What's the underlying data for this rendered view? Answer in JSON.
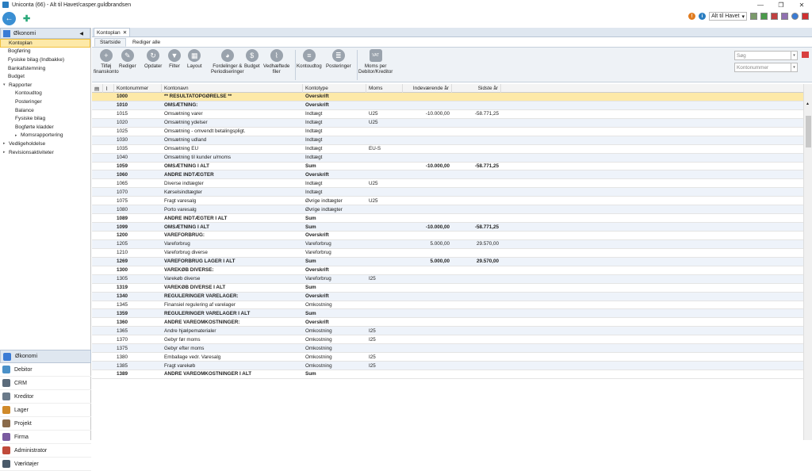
{
  "window": {
    "title": "Uniconta (66) - Alt til Havet/casper.guldbrandsen"
  },
  "topbar": {
    "company": "Alt til Havet"
  },
  "left": {
    "header": "Økonomi",
    "nav": [
      {
        "label": "Kontoplan",
        "level": 0,
        "selected": true
      },
      {
        "label": "Bogføring",
        "level": 0
      },
      {
        "label": "Fysiske bilag (Indbakke)",
        "level": 0
      },
      {
        "label": "Bankafstemning",
        "level": 0
      },
      {
        "label": "Budget",
        "level": 0
      },
      {
        "label": "Rapporter",
        "level": 1,
        "arrow": "▾"
      },
      {
        "label": "Kontoudtog",
        "level": 2
      },
      {
        "label": "Posteringer",
        "level": 2
      },
      {
        "label": "Balance",
        "level": 2
      },
      {
        "label": "Fysiske bilag",
        "level": 2
      },
      {
        "label": "Bogførte kladder",
        "level": 2
      },
      {
        "label": "Momsrapportering",
        "level": 2,
        "arrow": "▸"
      },
      {
        "label": "Vedligeholdelse",
        "level": 1,
        "arrow": "▸"
      },
      {
        "label": "Revisionsaktiviteter",
        "level": 1,
        "arrow": "▸"
      }
    ],
    "modules": [
      {
        "label": "Økonomi",
        "color": "#3a7bd5",
        "selected": true
      },
      {
        "label": "Debitor",
        "color": "#4a90c8"
      },
      {
        "label": "CRM",
        "color": "#5b6b7b"
      },
      {
        "label": "Kreditor",
        "color": "#6a7a8a"
      },
      {
        "label": "Lager",
        "color": "#d08a2a"
      },
      {
        "label": "Projekt",
        "color": "#8a6a4a"
      },
      {
        "label": "Firma",
        "color": "#7a5aa0"
      },
      {
        "label": "Administrator",
        "color": "#c04a3a"
      },
      {
        "label": "Værktøjer",
        "color": "#4a5a6a"
      }
    ]
  },
  "tabs": {
    "doc": "Kontoplan",
    "ribbon": [
      "Startside",
      "Rediger alle"
    ]
  },
  "ribbon": {
    "buttons": [
      {
        "label": "Tilføj\nfinanskonto",
        "glyph": "+"
      },
      {
        "label": "Rediger",
        "glyph": "✎"
      },
      {
        "label": "Opdater",
        "glyph": "↻"
      },
      {
        "label": "Filter",
        "glyph": "▼"
      },
      {
        "label": "Layout",
        "glyph": "▦"
      },
      {
        "label": "Fordelinger &\nPeriodiseringer",
        "glyph": "◕"
      },
      {
        "label": "Budget",
        "glyph": "$"
      },
      {
        "label": "Vedhæftede\nfiler",
        "glyph": "⌇"
      },
      {
        "label": "Kontoudtog",
        "glyph": "≡"
      },
      {
        "label": "Posteringer",
        "glyph": "≣"
      },
      {
        "label": "Moms per\nDebitor/Kreditor",
        "glyph": "VAT"
      }
    ],
    "search_placeholder": "Søg",
    "field_placeholder": "Kontonummer"
  },
  "grid": {
    "headers": [
      "Kontonummer",
      "Kontonavn",
      "Kontotype",
      "Moms",
      "Indeværende år",
      "Sidste år"
    ],
    "rows": [
      [
        "1000",
        "** RESULTATOPGØRELSE **",
        "Overskrift",
        "",
        "",
        "",
        "bold"
      ],
      [
        "1010",
        "OMSÆTNING:",
        "Overskrift",
        "",
        "",
        "",
        "bold"
      ],
      [
        "1015",
        "Omsætning varer",
        "Indtægt",
        "U25",
        "-10.000,00",
        "-58.771,25",
        ""
      ],
      [
        "1020",
        "Omsætning ydelser",
        "Indtægt",
        "U25",
        "",
        "",
        ""
      ],
      [
        "1025",
        "Omsætning -  omvendt betalingspligt.",
        "Indtægt",
        "",
        "",
        "",
        ""
      ],
      [
        "1030",
        "Omsætning udland",
        "Indtægt",
        "",
        "",
        "",
        ""
      ],
      [
        "1035",
        "Omsætning EU",
        "Indtægt",
        "EU-S",
        "",
        "",
        ""
      ],
      [
        "1040",
        "Omsætning til kunder u/moms",
        "Indtægt",
        "",
        "",
        "",
        ""
      ],
      [
        "1059",
        "OMSÆTNING I ALT",
        "Sum",
        "",
        "-10.000,00",
        "-58.771,25",
        "bold"
      ],
      [
        "1060",
        "ANDRE INDTÆGTER",
        "Overskrift",
        "",
        "",
        "",
        "bold"
      ],
      [
        "1065",
        "Diverse indtægter",
        "Indtægt",
        "U25",
        "",
        "",
        ""
      ],
      [
        "1070",
        "Kørselsindtægter",
        "Indtægt",
        "",
        "",
        "",
        ""
      ],
      [
        "1075",
        "Fragt varesalg",
        "Øvrige indtægter",
        "U25",
        "",
        "",
        ""
      ],
      [
        "1080",
        "Porto varesalg",
        "Øvrige indtægter",
        "",
        "",
        "",
        ""
      ],
      [
        "1089",
        "ANDRE INDTÆGTER I ALT",
        "Sum",
        "",
        "",
        "",
        "bold"
      ],
      [
        "1099",
        "OMSÆTNING I ALT",
        "Sum",
        "",
        "-10.000,00",
        "-58.771,25",
        "bold"
      ],
      [
        "1200",
        "VAREFORBRUG:",
        "Overskrift",
        "",
        "",
        "",
        "bold"
      ],
      [
        "1205",
        "Vareforbrug",
        "Vareforbrug",
        "",
        "5.000,00",
        "29.570,00",
        ""
      ],
      [
        "1210",
        "Vareforbrug diverse",
        "Vareforbrug",
        "",
        "",
        "",
        ""
      ],
      [
        "1269",
        "VAREFORBRUG LAGER I ALT",
        "Sum",
        "",
        "5.000,00",
        "29.570,00",
        "bold"
      ],
      [
        "1300",
        "VAREKØB DIVERSE:",
        "Overskrift",
        "",
        "",
        "",
        "bold"
      ],
      [
        "1305",
        "Varekøb  diverse",
        "Vareforbrug",
        "I25",
        "",
        "",
        ""
      ],
      [
        "1319",
        "VAREKØB DIVERSE I ALT",
        "Sum",
        "",
        "",
        "",
        "bold"
      ],
      [
        "1340",
        "REGULERINGER VARELAGER:",
        "Overskrift",
        "",
        "",
        "",
        "bold"
      ],
      [
        "1345",
        "Finansiel regulering af varelager",
        "Omkostning",
        "",
        "",
        "",
        ""
      ],
      [
        "1359",
        "REGULERINGER VARELAGER I ALT",
        "Sum",
        "",
        "",
        "",
        "bold"
      ],
      [
        "1360",
        "ANDRE VAREOMKOSTNINGER:",
        "Overskrift",
        "",
        "",
        "",
        "bold"
      ],
      [
        "1365",
        "Andre hjælpematerialer",
        "Omkostning",
        "I25",
        "",
        "",
        ""
      ],
      [
        "1370",
        "Gebyr før moms",
        "Omkostning",
        "I25",
        "",
        "",
        ""
      ],
      [
        "1375",
        "Gebyr efter moms",
        "Omkostning",
        "",
        "",
        "",
        ""
      ],
      [
        "1380",
        "Emballage vedr.  Varesalg",
        "Omkostning",
        "I25",
        "",
        "",
        ""
      ],
      [
        "1385",
        "Fragt varekøb",
        "Omkostning",
        "I25",
        "",
        "",
        ""
      ],
      [
        "1389",
        "ANDRE VAREOMKOSTNINGER I ALT",
        "Sum",
        "",
        "",
        "",
        "bold"
      ]
    ]
  }
}
